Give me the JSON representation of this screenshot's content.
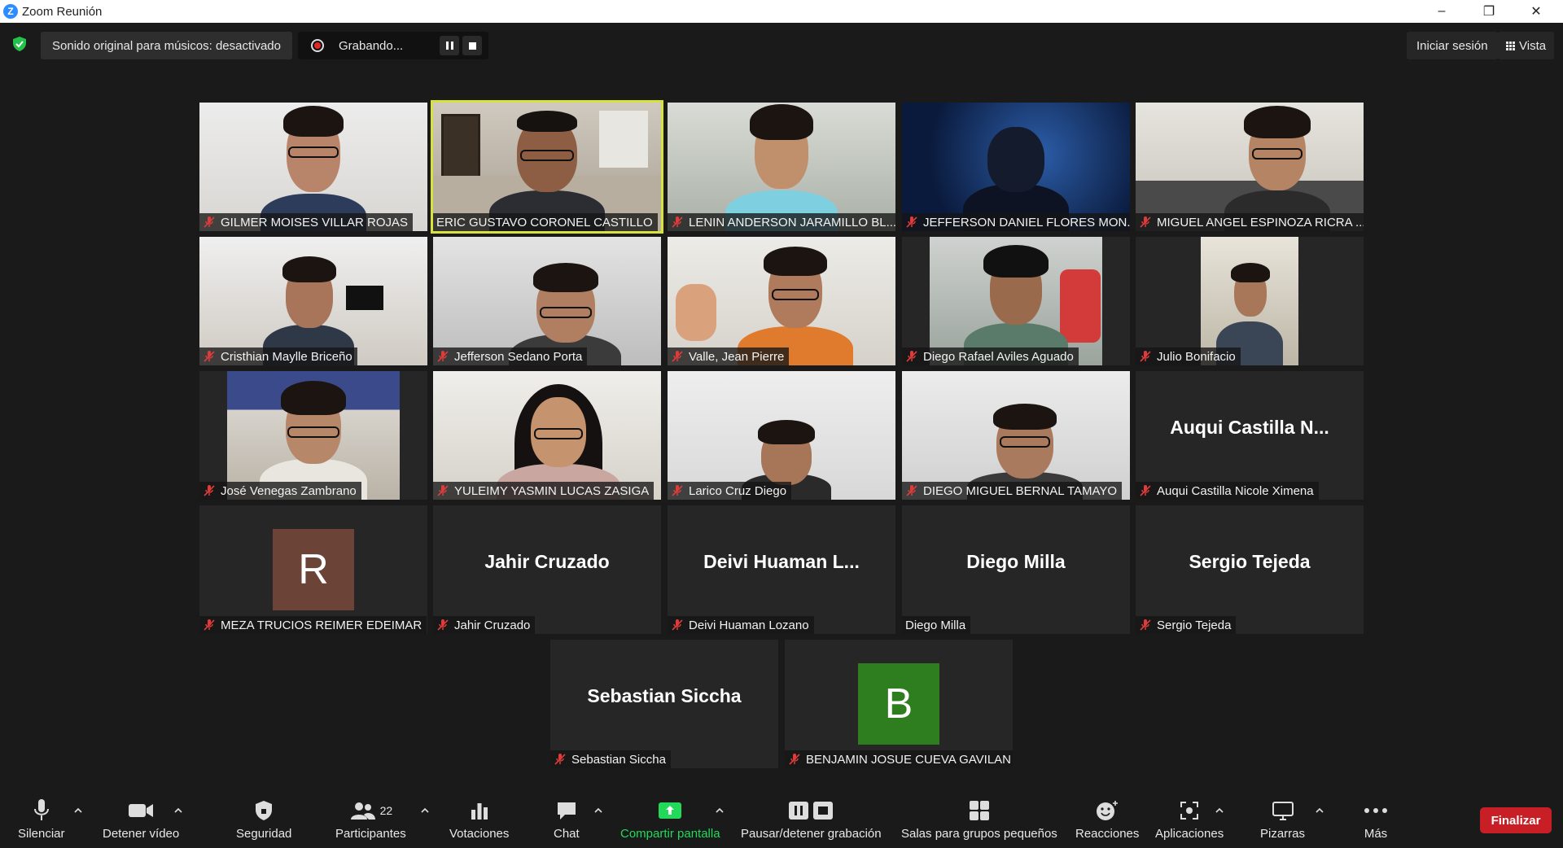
{
  "window": {
    "title": "Zoom Reunión"
  },
  "topbar": {
    "music_mode": "Sonido original para músicos: desactivado",
    "recording": "Grabando...",
    "signin": "Iniciar sesión",
    "view": "Vista"
  },
  "tiles": [
    {
      "name": "GILMER MOISES VILLAR ROJAS"
    },
    {
      "name": "ERIC GUSTAVO CORONEL CASTILLO"
    },
    {
      "name": "LENIN ANDERSON JARAMILLO BL..."
    },
    {
      "name": "JEFFERSON DANIEL FLORES MON..."
    },
    {
      "name": "MIGUEL ANGEL ESPINOZA RICRA ..."
    },
    {
      "name": "Cristhian Maylle Briceño"
    },
    {
      "name": "Jefferson Sedano Porta"
    },
    {
      "name": "Valle, Jean Pierre"
    },
    {
      "name": "Diego Rafael Aviles Aguado"
    },
    {
      "name": "Julio Bonifacio"
    },
    {
      "name": "José Venegas Zambrano"
    },
    {
      "name": "YULEIMY YASMIN LUCAS ZASIGA"
    },
    {
      "name": "Larico Cruz Diego"
    },
    {
      "name": "DIEGO MIGUEL BERNAL TAMAYO"
    },
    {
      "name": "Auqui Castilla Nicole Ximena",
      "display": "Auqui  Castilla  N..."
    },
    {
      "name": "MEZA TRUCIOS REIMER EDEIMAR",
      "avatar": "R"
    },
    {
      "name": "Jahir Cruzado",
      "display": "Jahir Cruzado"
    },
    {
      "name": "Deivi Huaman Lozano",
      "display": "Deivi  Huaman  L..."
    },
    {
      "name": "Diego Milla",
      "display": "Diego Milla"
    },
    {
      "name": "Sergio Tejeda",
      "display": "Sergio Tejeda"
    },
    {
      "name": "Sebastian Siccha",
      "display": "Sebastian Siccha"
    },
    {
      "name": "BENJAMIN JOSUE CUEVA GAVILAN",
      "avatar": "B"
    }
  ],
  "toolbar": {
    "mute": "Silenciar",
    "video": "Detener vídeo",
    "security": "Seguridad",
    "participants": "Participantes",
    "participants_count": "22",
    "polls": "Votaciones",
    "chat": "Chat",
    "share": "Compartir pantalla",
    "recording": "Pausar/detener grabación",
    "breakout": "Salas para grupos pequeños",
    "reactions": "Reacciones",
    "apps": "Aplicaciones",
    "whiteboards": "Pizarras",
    "more": "Más",
    "end": "Finalizar"
  },
  "colors": {
    "active_speaker": "#d9e23a",
    "share_green": "#23d959",
    "end_red": "#c81e25",
    "avatar_r": "#6b4437",
    "avatar_b": "#2e7d1f"
  }
}
